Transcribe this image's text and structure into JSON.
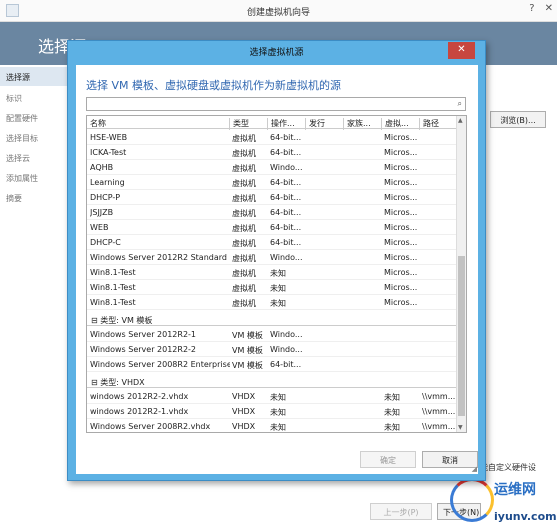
{
  "outer": {
    "title": "创建虚拟机向导",
    "heading": "选择源",
    "sidebar": [
      "选择源",
      "标识",
      "配置硬件",
      "选择目标",
      "选择云",
      "添加属性",
      "摘要"
    ],
    "browse_label": "浏览(B)...",
    "hardware_text": "能自定义硬件设",
    "prev_label": "上一步(P)",
    "next_label": "下一步(N)",
    "footer_text": ""
  },
  "watermark": {
    "cn": "运维网",
    "url": "iyunv.com"
  },
  "dialog": {
    "title": "选择虚拟机源",
    "heading": "选择 VM 模板、虚拟硬盘或虚拟机作为新虚拟机的源",
    "search_placeholder": "",
    "columns": [
      "名称",
      "类型",
      "操作...",
      "发行",
      "家族...",
      "虚拟...",
      "路径"
    ],
    "rows": [
      {
        "name": "HSE-WEB",
        "type": "虚拟机",
        "os": "64-bit...",
        "release": "",
        "family": "",
        "virt": "Micros...",
        "path": ""
      },
      {
        "name": "ICKA-Test",
        "type": "虚拟机",
        "os": "64-bit...",
        "release": "",
        "family": "",
        "virt": "Micros...",
        "path": ""
      },
      {
        "name": "AQHB",
        "type": "虚拟机",
        "os": "Windo...",
        "release": "",
        "family": "",
        "virt": "Micros...",
        "path": ""
      },
      {
        "name": "Learning",
        "type": "虚拟机",
        "os": "64-bit...",
        "release": "",
        "family": "",
        "virt": "Micros...",
        "path": ""
      },
      {
        "name": "DHCP-P",
        "type": "虚拟机",
        "os": "64-bit...",
        "release": "",
        "family": "",
        "virt": "Micros...",
        "path": ""
      },
      {
        "name": "JSJJZB",
        "type": "虚拟机",
        "os": "64-bit...",
        "release": "",
        "family": "",
        "virt": "Micros...",
        "path": ""
      },
      {
        "name": "WEB",
        "type": "虚拟机",
        "os": "64-bit...",
        "release": "",
        "family": "",
        "virt": "Micros...",
        "path": ""
      },
      {
        "name": "DHCP-C",
        "type": "虚拟机",
        "os": "64-bit...",
        "release": "",
        "family": "",
        "virt": "Micros...",
        "path": ""
      },
      {
        "name": "Windows Server 2012R2 Standard",
        "type": "虚拟机",
        "os": "Windo...",
        "release": "",
        "family": "",
        "virt": "Micros...",
        "path": ""
      },
      {
        "name": "Win8.1-Test",
        "type": "虚拟机",
        "os": "未知",
        "release": "",
        "family": "",
        "virt": "Micros...",
        "path": ""
      },
      {
        "name": "Win8.1-Test",
        "type": "虚拟机",
        "os": "未知",
        "release": "",
        "family": "",
        "virt": "Micros...",
        "path": ""
      },
      {
        "name": "Win8.1-Test",
        "type": "虚拟机",
        "os": "未知",
        "release": "",
        "family": "",
        "virt": "Micros...",
        "path": ""
      }
    ],
    "group_vm": "⊟ 类型: VM 模板",
    "vm_rows": [
      {
        "name": "Windows Server 2012R2-1",
        "type": "VM 模板",
        "os": "Windo...",
        "release": "",
        "family": "",
        "virt": "",
        "path": ""
      },
      {
        "name": "Windows Server 2012R2-2",
        "type": "VM 模板",
        "os": "Windo...",
        "release": "",
        "family": "",
        "virt": "",
        "path": ""
      },
      {
        "name": "Windows Server 2008R2 Enterprise",
        "type": "VM 模板",
        "os": "64-bit...",
        "release": "",
        "family": "",
        "virt": "",
        "path": ""
      }
    ],
    "group_vhdx": "⊟ 类型: VHDX",
    "vhdx_rows": [
      {
        "name": "windows 2012R2-2.vhdx",
        "type": "VHDX",
        "os": "未知",
        "release": "",
        "family": "",
        "virt": "未知",
        "path": "\\\\vmm..."
      },
      {
        "name": "windows 2012R2-1.vhdx",
        "type": "VHDX",
        "os": "未知",
        "release": "",
        "family": "",
        "virt": "未知",
        "path": "\\\\vmm..."
      },
      {
        "name": "Windows Server 2008R2.vhdx",
        "type": "VHDX",
        "os": "未知",
        "release": "",
        "family": "",
        "virt": "未知",
        "path": "\\\\vmm..."
      }
    ],
    "ok_label": "确定",
    "cancel_label": "取消"
  },
  "colors": {
    "accent": "#5cb1e4",
    "band": "#6a86a1",
    "close": "#c7463f",
    "heading": "#2f66b0"
  },
  "icons": {
    "search": "search-icon",
    "close": "close-icon"
  }
}
